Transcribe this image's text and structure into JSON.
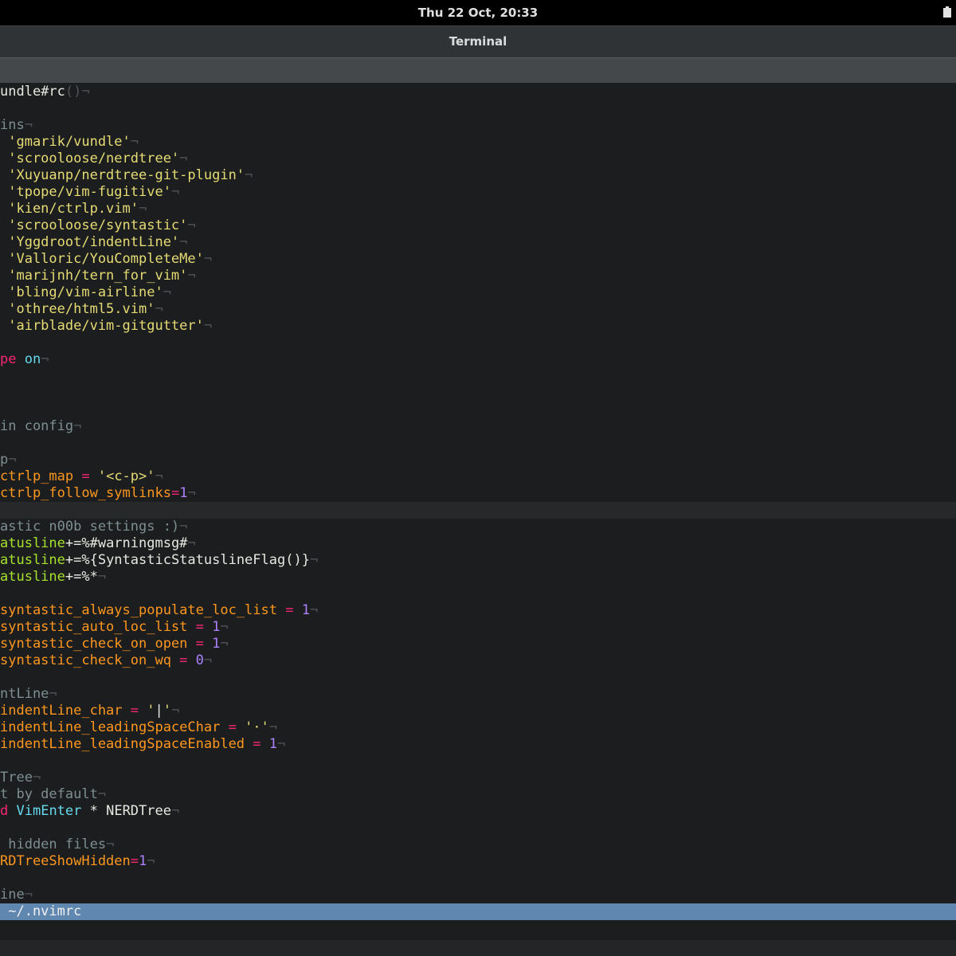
{
  "system_bar": {
    "clock": "Thu 22 Oct, 20:33"
  },
  "window": {
    "title": "Terminal"
  },
  "editor": {
    "lines": [
      [
        {
          "t": "undle#rc",
          "c": "text"
        },
        {
          "t": "()",
          "c": "nt"
        },
        {
          "t": "¬",
          "c": "nt"
        }
      ],
      [],
      [
        {
          "t": "ins",
          "c": "com"
        },
        {
          "t": "¬",
          "c": "nt"
        }
      ],
      [
        {
          "t": " 'gmarik/vundle'",
          "c": "str"
        },
        {
          "t": "¬",
          "c": "nt"
        }
      ],
      [
        {
          "t": " 'scrooloose/nerdtree'",
          "c": "str"
        },
        {
          "t": "¬",
          "c": "nt"
        }
      ],
      [
        {
          "t": " 'Xuyuanp/nerdtree-git-plugin'",
          "c": "str"
        },
        {
          "t": "¬",
          "c": "nt"
        }
      ],
      [
        {
          "t": " 'tpope/vim-fugitive'",
          "c": "str"
        },
        {
          "t": "¬",
          "c": "nt"
        }
      ],
      [
        {
          "t": " 'kien/ctrlp.vim'",
          "c": "str"
        },
        {
          "t": "¬",
          "c": "nt"
        }
      ],
      [
        {
          "t": " 'scrooloose/syntastic'",
          "c": "str"
        },
        {
          "t": "¬",
          "c": "nt"
        }
      ],
      [
        {
          "t": " 'Yggdroot/indentLine'",
          "c": "str"
        },
        {
          "t": "¬",
          "c": "nt"
        }
      ],
      [
        {
          "t": " 'Valloric/YouCompleteMe'",
          "c": "str"
        },
        {
          "t": "¬",
          "c": "nt"
        }
      ],
      [
        {
          "t": " 'marijnh/tern_for_vim'",
          "c": "str"
        },
        {
          "t": "¬",
          "c": "nt"
        }
      ],
      [
        {
          "t": " 'bling/vim-airline'",
          "c": "str"
        },
        {
          "t": "¬",
          "c": "nt"
        }
      ],
      [
        {
          "t": " 'othree/html5.vim'",
          "c": "str"
        },
        {
          "t": "¬",
          "c": "nt"
        }
      ],
      [
        {
          "t": " 'airblade/vim-gitgutter'",
          "c": "str"
        },
        {
          "t": "¬",
          "c": "nt"
        }
      ],
      [],
      [
        {
          "t": "pe",
          "c": "kw"
        },
        {
          "t": " ",
          "c": "text"
        },
        {
          "t": "on",
          "c": "on"
        },
        {
          "t": "¬",
          "c": "nt"
        }
      ],
      [],
      [],
      [],
      [
        {
          "t": "in config",
          "c": "com"
        },
        {
          "t": "¬",
          "c": "nt"
        }
      ],
      [],
      [
        {
          "t": "p",
          "c": "com"
        },
        {
          "t": "¬",
          "c": "nt"
        }
      ],
      [
        {
          "t": "ctrlp_map",
          "c": "var"
        },
        {
          "t": " = ",
          "c": "op"
        },
        {
          "t": "'<c-p>'",
          "c": "str"
        },
        {
          "t": "¬",
          "c": "nt"
        }
      ],
      [
        {
          "t": "ctrlp_follow_symlinks",
          "c": "var"
        },
        {
          "t": "=",
          "c": "op"
        },
        {
          "t": "1",
          "c": "num"
        },
        {
          "t": "¬",
          "c": "nt"
        }
      ],
      [],
      [
        {
          "t": "astic n00b settings :)",
          "c": "com"
        },
        {
          "t": "¬",
          "c": "nt"
        }
      ],
      [
        {
          "t": "atusline",
          "c": "opt"
        },
        {
          "t": "+=%#warningmsg#",
          "c": "text"
        },
        {
          "t": "¬",
          "c": "nt"
        }
      ],
      [
        {
          "t": "atusline",
          "c": "opt"
        },
        {
          "t": "+=%{SyntasticStatuslineFlag()}",
          "c": "text"
        },
        {
          "t": "¬",
          "c": "nt"
        }
      ],
      [
        {
          "t": "atusline",
          "c": "opt"
        },
        {
          "t": "+=%*",
          "c": "text"
        },
        {
          "t": "¬",
          "c": "nt"
        }
      ],
      [],
      [
        {
          "t": "syntastic_always_populate_loc_list",
          "c": "var"
        },
        {
          "t": " = ",
          "c": "op"
        },
        {
          "t": "1",
          "c": "num"
        },
        {
          "t": "¬",
          "c": "nt"
        }
      ],
      [
        {
          "t": "syntastic_auto_loc_list",
          "c": "var"
        },
        {
          "t": " = ",
          "c": "op"
        },
        {
          "t": "1",
          "c": "num"
        },
        {
          "t": "¬",
          "c": "nt"
        }
      ],
      [
        {
          "t": "syntastic_check_on_open",
          "c": "var"
        },
        {
          "t": " = ",
          "c": "op"
        },
        {
          "t": "1",
          "c": "num"
        },
        {
          "t": "¬",
          "c": "nt"
        }
      ],
      [
        {
          "t": "syntastic_check_on_wq",
          "c": "var"
        },
        {
          "t": " = ",
          "c": "op"
        },
        {
          "t": "0",
          "c": "num"
        },
        {
          "t": "¬",
          "c": "nt"
        }
      ],
      [],
      [
        {
          "t": "ntLine",
          "c": "com"
        },
        {
          "t": "¬",
          "c": "nt"
        }
      ],
      [
        {
          "t": "indentLine_char",
          "c": "var"
        },
        {
          "t": " = ",
          "c": "op"
        },
        {
          "t": "'",
          "c": "str"
        },
        {
          "t": "|",
          "c": "text"
        },
        {
          "t": "'",
          "c": "str"
        },
        {
          "t": "¬",
          "c": "nt"
        }
      ],
      [
        {
          "t": "indentLine_leadingSpaceChar",
          "c": "var"
        },
        {
          "t": " = ",
          "c": "op"
        },
        {
          "t": "'·'",
          "c": "str"
        },
        {
          "t": "¬",
          "c": "nt"
        }
      ],
      [
        {
          "t": "indentLine_leadingSpaceEnabled",
          "c": "var"
        },
        {
          "t": " = ",
          "c": "op"
        },
        {
          "t": "1",
          "c": "num"
        },
        {
          "t": "¬",
          "c": "nt"
        }
      ],
      [],
      [
        {
          "t": "Tree",
          "c": "com"
        },
        {
          "t": "¬",
          "c": "nt"
        }
      ],
      [
        {
          "t": "t by default",
          "c": "com"
        },
        {
          "t": "¬",
          "c": "nt"
        }
      ],
      [
        {
          "t": "d",
          "c": "kw"
        },
        {
          "t": " ",
          "c": "text"
        },
        {
          "t": "VimEnter",
          "c": "on"
        },
        {
          "t": " * NERDTree",
          "c": "text"
        },
        {
          "t": "¬",
          "c": "nt"
        }
      ],
      [],
      [
        {
          "t": " hidden files",
          "c": "com"
        },
        {
          "t": "¬",
          "c": "nt"
        }
      ],
      [
        {
          "t": "RDTreeShowHidden",
          "c": "var"
        },
        {
          "t": "=",
          "c": "op"
        },
        {
          "t": "1",
          "c": "num"
        },
        {
          "t": "¬",
          "c": "nt"
        }
      ],
      [],
      [
        {
          "t": "ine",
          "c": "com"
        },
        {
          "t": "¬",
          "c": "nt"
        }
      ]
    ],
    "cursorline_index": 25,
    "statusline": " ~/.nvimrc"
  },
  "colors": {
    "background": "#1b1d1e",
    "text": "#e8e8e2",
    "string": "#e6db74",
    "comment": "#7e8e91",
    "keyword": "#f92672",
    "identifier": "#fd971f",
    "number": "#ae81ff",
    "option": "#a6e22e",
    "type": "#66d9ef",
    "statusline": "#5f87af"
  }
}
